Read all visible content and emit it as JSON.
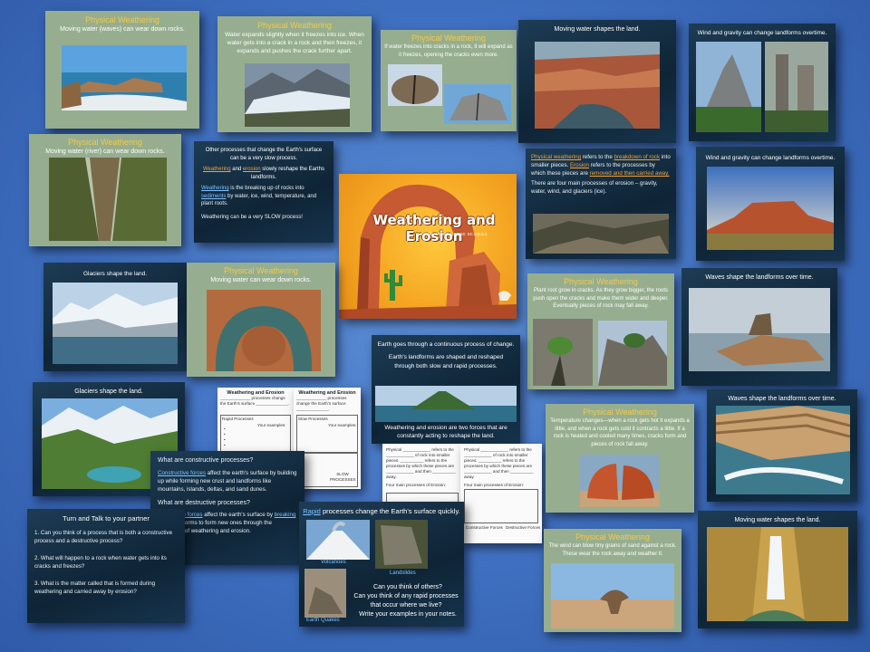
{
  "cover": {
    "title": "Weathering and Erosion",
    "subtitle": "CCSS: 4-ESS2-1  NGSS: SC.4.E.6.4"
  },
  "s1": {
    "title": "Physical Weathering",
    "body": "Moving water (waves) can wear down rocks."
  },
  "s2": {
    "title": "Physical Weathering",
    "body": "Water expands slightly when it freezes into ice. When water gets into a crack in a rock and then freezes, it expands and pushes the crack further apart."
  },
  "s3": {
    "title": "Physical Weathering",
    "body": "If water freezes into cracks in a rock, it will expand as it freezes, opening the cracks even more."
  },
  "s4": {
    "title": "Moving water shapes the land."
  },
  "s5": {
    "title": "Wind and gravity can change landforms overtime."
  },
  "s6": {
    "title": "Physical Weathering",
    "body": "Moving water (river) can wear down rocks."
  },
  "s7": {
    "p1": "Other processes that change the Earth's surface can be a very slow process.",
    "p2a": "Weathering",
    "p2b": " and ",
    "p2c": "erosion",
    "p2d": " slowly reshape the Earths landforms.",
    "p3a": "Weathering",
    "p3b": " is the breaking up of rocks into ",
    "p3c": "sediments",
    "p3d": " by water, ice, wind, temperature, and plant roots.",
    "p4": "Weathering can be a very SLOW process!"
  },
  "s8": {
    "a": "Physical weathering",
    "b": " refers to the ",
    "c": "breakdown of rock",
    "d": " into smaller pieces. ",
    "e": "Erosion",
    "f": " refers to the processes by which these pieces are ",
    "g": "removed and then carried away.",
    "h": "There are four main processes of erosion – gravity, water, wind, and glaciers (ice)."
  },
  "s9": {
    "title": "Wind  and gravity can change landforms overtime."
  },
  "s10": {
    "title": "Glaciers shape the land."
  },
  "s11": {
    "title": "Physical Weathering",
    "body": "Moving water can wear down rocks."
  },
  "s12": {
    "title": "Physical Weathering",
    "body": "Plant root grow in cracks. As they grow bigger, the roots push open the cracks and make them wider and deeper. Eventually pieces of rock may fall away."
  },
  "s13": {
    "title": "Waves shape the landforms over time."
  },
  "s14": {
    "p1": "Earth goes through a continuous process of change.",
    "p2": "Earth's landforms are shaped  and reshaped through both slow and  rapid processes.",
    "p3": "Weathering and erosion are two forces that are constantly acting to reshape the land."
  },
  "s15": {
    "title": "Glaciers shape the land."
  },
  "ws1": {
    "title": "Weathering and Erosion",
    "line1": "_____________ processes change the Earth's surface ______________.",
    "col": "Rapid Processes",
    "ex": "Your examples:",
    "line2": "_____________ is the ________ up of rocks into ___________.",
    "bullets": [
      "•",
      "•",
      "•",
      "•"
    ],
    "num": "1."
  },
  "ws2": {
    "title": "Weathering and Erosion",
    "line1": "_____________ processes change the Earth's surface ______________.",
    "col": "Slow Processes",
    "ex": "Your examples:",
    "num1": "1.",
    "num2": "2.",
    "box": "SLOW PROCESSES"
  },
  "ws3": {
    "line1": "Physical ____________ refers to the ____________ of rock into smaller pieces. __________ refers to the processes by which these pieces are ____________ and then __________ away.",
    "line2": "Four main processes of Erosion:"
  },
  "ws4": {
    "line1": "Physical ____________ refers to the ____________ of rock into smaller pieces. __________ refers to the processes by which these pieces are ____________ and then __________ away.",
    "line2": "Four main processes of Erosion:",
    "c1": "Constructive Forces",
    "c2": "Destructive Forces"
  },
  "s16": {
    "title": "Waves shape the landforms over time."
  },
  "s17": {
    "title": "Physical Weathering",
    "body": "Temperature changes—when a rock gets hot it expands a little, and when a rock gets cold it contracts a little. If a rock is heated and cooled many times, cracks form and pieces of rock fall away."
  },
  "s18": {
    "q": "What are constructive processes?",
    "p1a": "Constructive forces",
    "p1b": " affect the earth's surface by building up while forming new crust and landforms like mountains, islands, deltas, and sand dunes.",
    "q2": "What are destructive processes?",
    "p2a": "Destructive forces",
    "p2b": " affect the earth's surface by ",
    "p2c": "breaking down",
    "p2d": " landforms to form new ones through the processes of weathering and erosion."
  },
  "s19": {
    "title": "Turn and Talk to your partner",
    "q1": "1.  Can you think of a process that  is both a constructive process and a  destructive process?",
    "q2": "2.  What will happen to a rock when water gets into its cracks and freezes?",
    "q3": "3.  What is the matter called that is formed during weathering and carried away by erosion?"
  },
  "s20": {
    "title_a": "Rapid",
    "title_b": " processes  change the Earth's surface quickly.",
    "cap1": "Volcanoes",
    "cap2": "Landslides",
    "cap3": "Earth Quakes",
    "q1": "Can you think of others?",
    "q2": "Can you think of any rapid processes that occur where we live?",
    "q3": "Write your examples in your notes."
  },
  "s21": {
    "title": "Physical Weathering",
    "body": "The wind can blow tiny grains of sand against a rock. These wear the rock away and weather it."
  },
  "s22": {
    "title": "Moving water shapes the land."
  }
}
